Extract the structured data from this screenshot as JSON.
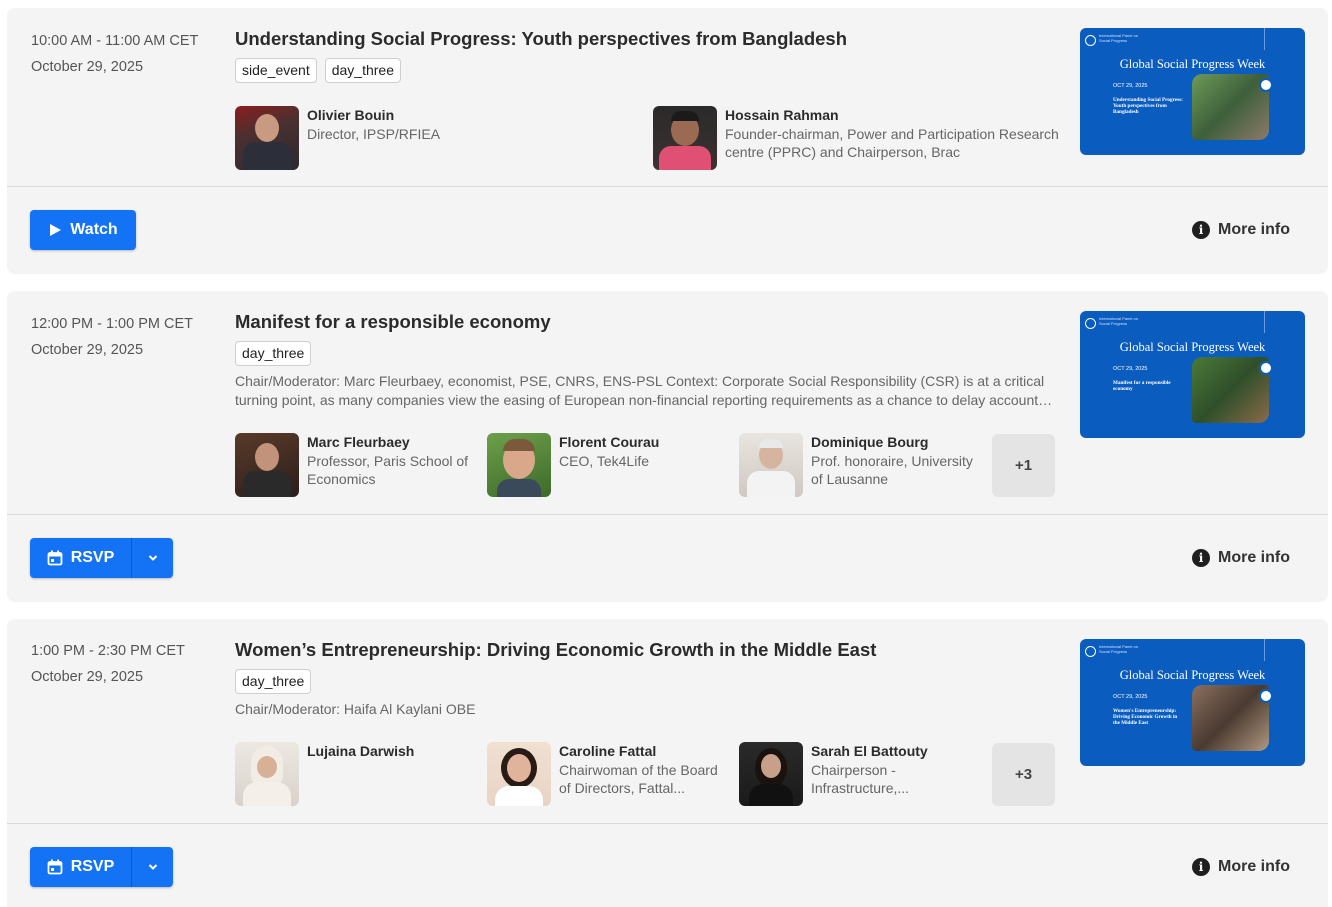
{
  "events": [
    {
      "time": "10:00 AM - 11:00 AM CET",
      "date": "October 29, 2025",
      "title": "Understanding Social Progress: Youth perspectives from Bangladesh",
      "tags": [
        "side_event",
        "day_three"
      ],
      "speakers": [
        {
          "name": "Olivier Bouin",
          "role1": "Director, IPSP/RFIEA",
          "role2": ""
        },
        {
          "name": "Hossain Rahman",
          "role1": "Founder-chairman, Power and Participation Research",
          "role2": "centre (PPRC) and Chairperson, Brac"
        }
      ],
      "thumb": {
        "org": "International Panel on Social Progress",
        "week": "Global Social Progress Week",
        "date": "OCT 29, 2025",
        "subtitle": "Understanding Social Progress: Youth perspectives from Bangladesh"
      },
      "action_label": "Watch",
      "more_info": "More info"
    },
    {
      "time": "12:00 PM - 1:00 PM CET",
      "date": "October 29, 2025",
      "title": "Manifest for a responsible economy",
      "tags": [
        "day_three"
      ],
      "desc1": "Chair/Moderator: Marc Fleurbaey, economist, PSE, CNRS, ENS-PSL Context: Corporate Social Responsibility (CSR) is at a critical",
      "desc2": "turning point, as many companies view the easing of European non-financial reporting requirements as a chance to delay accountabili...",
      "speakers": [
        {
          "name": "Marc Fleurbaey",
          "role1": "Professor, Paris School of",
          "role2": "Economics"
        },
        {
          "name": "Florent Courau",
          "role1": "CEO, Tek4Life",
          "role2": ""
        },
        {
          "name": "Dominique Bourg",
          "role1": "Prof. honoraire, University",
          "role2": "of Lausanne"
        }
      ],
      "more_speakers": "+1",
      "thumb": {
        "org": "International Panel on Social Progress",
        "week": "Global Social Progress Week",
        "date": "OCT 29, 2025",
        "subtitle": "Manifest for a responsible economy"
      },
      "action_label": "RSVP",
      "more_info": "More info"
    },
    {
      "time": "1:00 PM - 2:30 PM CET",
      "date": "October 29, 2025",
      "title": "Women’s Entrepreneurship: Driving Economic Growth in the Middle East",
      "tags": [
        "day_three"
      ],
      "desc1": "Chair/Moderator: Haifa Al Kaylani OBE",
      "speakers": [
        {
          "name": "Lujaina Darwish",
          "role1": "",
          "role2": ""
        },
        {
          "name": "Caroline Fattal",
          "role1": "Chairwoman of the Board",
          "role2": "of Directors, Fattal..."
        },
        {
          "name": "Sarah El Battouty",
          "role1": "Chairperson -",
          "role2": "Infrastructure,..."
        }
      ],
      "more_speakers": "+3",
      "thumb": {
        "org": "International Panel on Social Progress",
        "week": "Global Social Progress Week",
        "date": "OCT 29, 2025",
        "subtitle": "Women's Entrepreneurship: Driving Economic Growth in the Middle East"
      },
      "action_label": "RSVP",
      "more_info": "More info"
    }
  ],
  "colors": {
    "accent": "#1473f5",
    "card_bg": "#f4f4f4",
    "thumb_blue": "#0b5cbf"
  },
  "icons": {
    "play": "play-icon",
    "calendar": "calendar-icon",
    "chevron": "chevron-down-icon",
    "info": "info-icon"
  }
}
